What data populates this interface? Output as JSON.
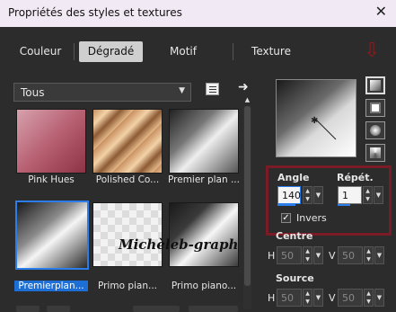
{
  "window": {
    "title": "Propriétés des styles et textures",
    "close_glyph": "✕"
  },
  "tabs": [
    {
      "label": "Couleur",
      "active": false
    },
    {
      "label": "Dégradé",
      "active": true
    },
    {
      "label": "Motif",
      "active": false
    },
    {
      "label": "Texture",
      "active": false
    }
  ],
  "category": {
    "value": "Tous"
  },
  "icons": {
    "preset-list-icon": "list-icon",
    "import-icon": "arrow-right-icon"
  },
  "gradients": [
    {
      "caption": "Pink Hues",
      "selected": false
    },
    {
      "caption": "Polished Co...",
      "selected": false
    },
    {
      "caption": "Premier plan ...",
      "selected": false
    },
    {
      "caption": "Premierplan...",
      "selected": true
    },
    {
      "caption": "Primo pian...",
      "selected": false
    },
    {
      "caption": "Primo piano...",
      "selected": false
    }
  ],
  "watermark": "Michèleb-graph",
  "settings": {
    "angle_label": "Angle",
    "angle_value": "140",
    "repeat_label": "Répét.",
    "repeat_value": "1",
    "invert_label": "Invers",
    "invert_checked": true,
    "center_label": "Centre",
    "center_h_label": "H",
    "center_h": "50",
    "center_v_label": "V",
    "center_v": "50",
    "source_label": "Source",
    "source_h_label": "H",
    "source_h": "50",
    "source_v_label": "V",
    "source_v": "50"
  },
  "glyphs": {
    "down_arrow": "⇩",
    "check": "✓",
    "right_arrow": "➜",
    "spin": "▲▼",
    "dd": "▼"
  },
  "colors": {
    "accent": "#2b7de9",
    "highlight_box": "#7a1b25",
    "annotation_arrow": "#8e1b1b"
  }
}
